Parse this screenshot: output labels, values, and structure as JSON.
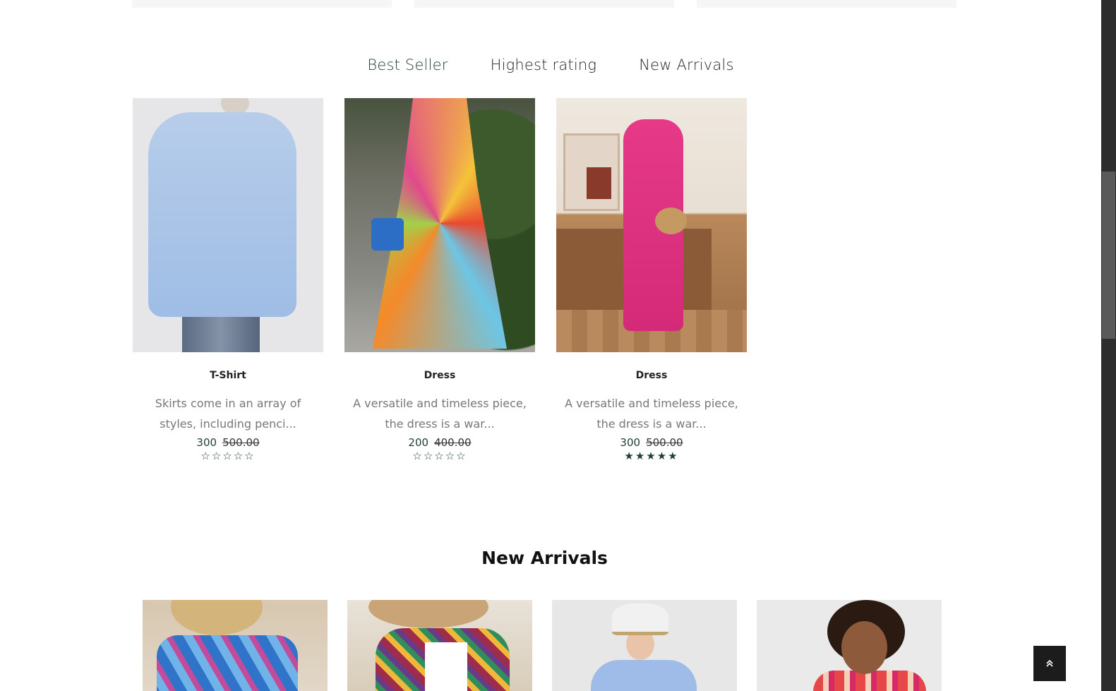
{
  "tabs": [
    {
      "label": "Best Seller",
      "active": true
    },
    {
      "label": "Highest rating",
      "active": false
    },
    {
      "label": "New Arrivals",
      "active": false
    }
  ],
  "products": [
    {
      "title": "T-Shirt",
      "description": "Skirts come in an array of styles, including penci...",
      "price": "300",
      "old_price": "500.00",
      "rating_stars": "☆☆☆☆☆",
      "rating": 0
    },
    {
      "title": "Dress",
      "description": "A versatile and timeless piece, the dress is a war...",
      "price": "200",
      "old_price": "400.00",
      "rating_stars": "☆☆☆☆☆",
      "rating": 0
    },
    {
      "title": "Dress",
      "description": "A versatile and timeless piece, the dress is a war...",
      "price": "300",
      "old_price": "500.00",
      "rating_stars": "★★★★★",
      "rating": 5
    }
  ],
  "new_arrivals": {
    "title": "New Arrivals"
  },
  "icons": {
    "scroll_top": "double-chevron-up-icon",
    "scroll_top_glyph": "⌃"
  },
  "colors": {
    "accent": "#1f3d36",
    "scroll_button": "#1c1c1c"
  }
}
